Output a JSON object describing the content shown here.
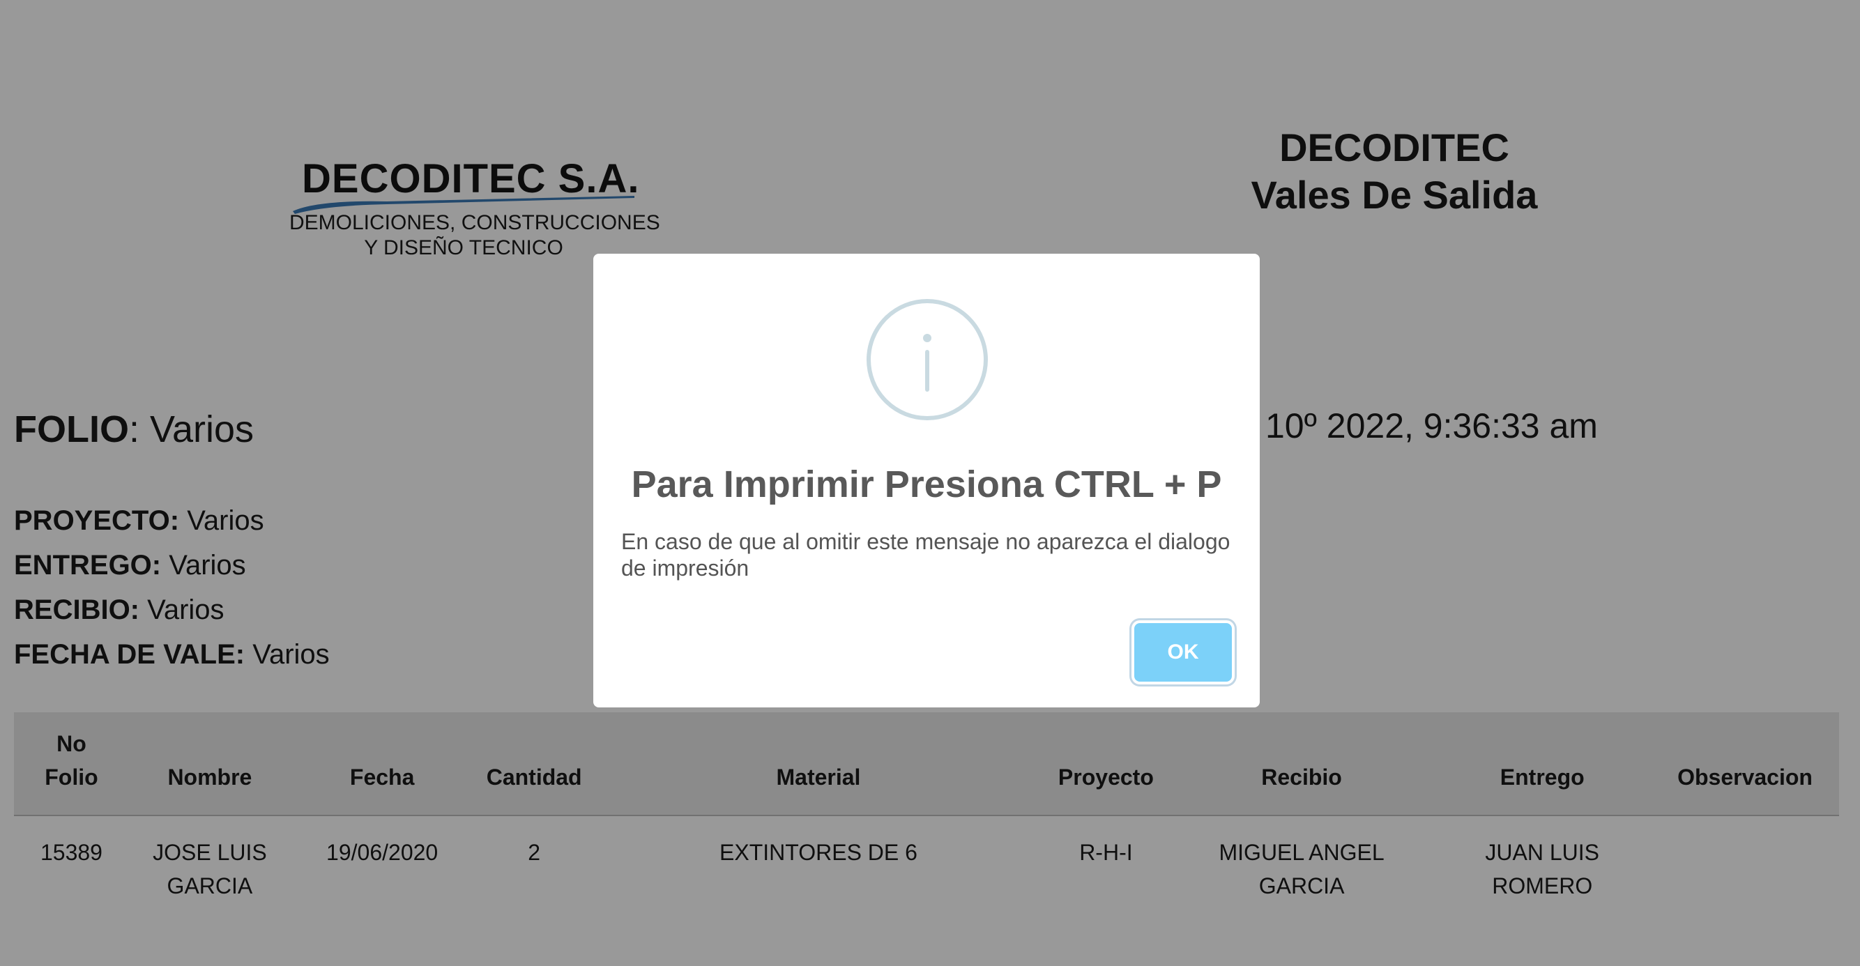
{
  "logo": {
    "title": "DECODITEC S.A.",
    "subtitle_line1": "DEMOLICIONES, CONSTRUCCIONES",
    "subtitle_line2": "Y DISEÑO TECNICO"
  },
  "header": {
    "company": "DECODITEC",
    "subtitle": "Vales De Salida"
  },
  "folio": {
    "label": "FOLIO",
    "value": "Varios"
  },
  "date_line": "10º 2022, 9:36:33 am",
  "info": {
    "proyecto_label": "PROYECTO:",
    "proyecto_value": "Varios",
    "entrego_label": "ENTREGO:",
    "entrego_value": "Varios",
    "recibio_label": "RECIBIO:",
    "recibio_value": "Varios",
    "fecha_label": "FECHA DE VALE:",
    "fecha_value": "Varios"
  },
  "table": {
    "headers": {
      "no_folio_1": "No",
      "no_folio_2": "Folio",
      "nombre": "Nombre",
      "fecha": "Fecha",
      "cantidad": "Cantidad",
      "material": "Material",
      "proyecto": "Proyecto",
      "recibio": "Recibio",
      "entrego": "Entrego",
      "observacion": "Observacion"
    },
    "rows": [
      {
        "folio": "15389",
        "nombre_1": "JOSE LUIS",
        "nombre_2": "GARCIA",
        "fecha": "19/06/2020",
        "cantidad": "2",
        "material": "EXTINTORES DE 6",
        "proyecto": "R-H-I",
        "recibio_1": "MIGUEL ANGEL",
        "recibio_2": "GARCIA",
        "entrego_1": "JUAN LUIS",
        "entrego_2": "ROMERO",
        "observacion": ""
      }
    ]
  },
  "modal": {
    "icon": "info-icon",
    "title": "Para Imprimir Presiona CTRL + P",
    "text": "En caso de que al omitir este mensaje no aparezca el dialogo de impresión",
    "ok_label": "OK"
  },
  "colors": {
    "overlay": "rgba(0,0,0,0.4)",
    "ok_button": "#7cd1f9",
    "icon_stroke": "#c9dae1",
    "table_header_bg": "#e8e8e8",
    "logo_swoosh": "#3a78b5"
  }
}
